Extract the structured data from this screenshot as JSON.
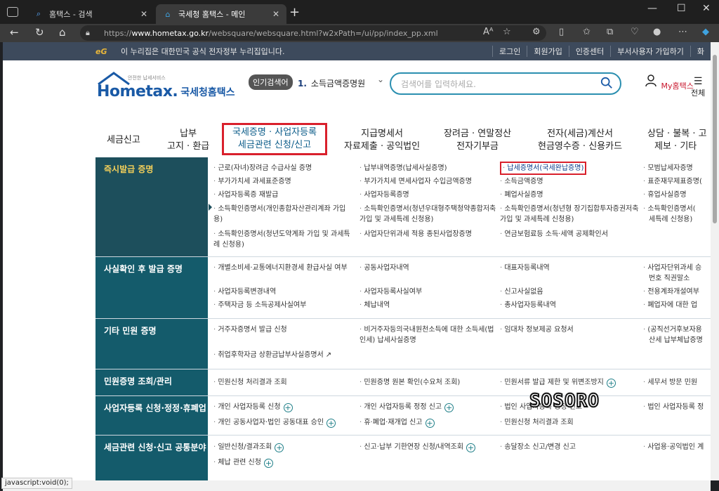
{
  "browser": {
    "tabs": [
      {
        "title": "홈택스 - 검색",
        "icon": "search-icon"
      },
      {
        "title": "국세청 홈택스 - 메인",
        "icon": "hometax-favicon"
      }
    ],
    "url_prefix": "https://",
    "url_host": "www.hometax.go.kr",
    "url_path": "/websquare/websquare.html?w2xPath=/ui/pp/index_pp.xml",
    "status_text": "javascript:void(0);"
  },
  "gov_bar": {
    "logo": "eG",
    "notice": "이 누리집은 대한민국 공식 전자정부 누리집입니다.",
    "links": [
      "로그인",
      "회원가입",
      "인증센터",
      "부서사용자 가입하기",
      "화"
    ]
  },
  "header": {
    "logo_small": "안전한 납세서비스",
    "logo_home": "Hometax.",
    "logo_name": "국세청홈택스",
    "popular_label": "인기검색어",
    "popular_rank": "1.",
    "popular_term": "소득금액증명원",
    "search_placeholder": "검색어를 입력하세요.",
    "my_label": "My홈택스",
    "all_label": "전체"
  },
  "main_nav": [
    {
      "line1": "세금신고",
      "line2": ""
    },
    {
      "line1": "납부",
      "line2": "고지 · 환급"
    },
    {
      "line1": "국세증명 · 사업자등록",
      "line2": "세금관련 신청/신고"
    },
    {
      "line1": "지급명세서",
      "line2": "자료제출 · 공익법인"
    },
    {
      "line1": "장려금 · 연말정산",
      "line2": "전자기부금"
    },
    {
      "line1": "전자(세금)계산서",
      "line2": "현금영수증 · 신용카드"
    },
    {
      "line1": "상담 · 불복 · 고",
      "line2": "제보 · 기타"
    }
  ],
  "sections": [
    {
      "title": "즉시발급 증명",
      "items": [
        "근로(자녀)장려금 수급사실 증명",
        "납부내역증명(납세사실증명)",
        "납세증명서(국세완납증명)",
        "모범납세자증명",
        "부가가치세 과세표준증명",
        "부가가치세 면세사업자 수입금액증명",
        "소득금액증명",
        "표준재무제표증명(",
        "사업자등록증 재발급",
        "사업자등록증명",
        "폐업사실증명",
        "휴업사실증명",
        "소득확인증명서(개인종합자산관리계좌 가입용)",
        "소득확인증명서(청년우대형주택청약종합저축 가입 및 과세특례 신청용)",
        "소득확인증명서(청년형 장기집합투자증권저축 가입 및 과세특례 신청용)",
        "소득확인증명서(",
        "세특례 신청용)",
        "소득확인증명서(청년도약계좌 가입 및 과세특례 신청용)",
        "사업자단위과세 적용 종된사업장증명",
        "연금보험료등 소득·세액 공제확인서"
      ]
    },
    {
      "title": "사실확인 후 발급 증명",
      "items": [
        "개별소비세·교통에너지환경세 환급사실 여부",
        "공동사업자내역",
        "대표자등록내역",
        "사업자단위과세 승",
        "번호 직권말소",
        "사업자등록변경내역",
        "사업자등록사실여부",
        "신고사실없음",
        "전용계좌개설여부",
        "주택자금 등 소득공제사실여부",
        "체납내역",
        "총사업자등록내역",
        "폐업자에 대한 업"
      ]
    },
    {
      "title": "기타 민원 증명",
      "items": [
        "거주자증명서 발급 신청",
        "비거주자등의국내원천소득에 대한 소득세(법인세) 납세사실증명",
        "임대차 정보제공 요청서",
        "(공직선거후보자용",
        "산세 납부체납증명",
        "취업후학자금 상환금납부사실증명서"
      ]
    },
    {
      "title": "민원증명 조회/관리",
      "items": [
        "민원신청 처리결과 조회",
        "민원증명 원본 확인(수요처 조회)",
        "민원서류 발급 제한 및 위변조방지",
        "세무서 방문 민원"
      ]
    },
    {
      "title": "사업자등록 신청·정정·휴폐업",
      "items": [
        "개인 사업자등록 신청",
        "개인 사업자등록 정정 신고",
        "법인 사업자등록 정정 신고",
        "법인 사업자등록 정",
        "개인 공동사업자·법인 공동대표 승인",
        "휴·폐업·재개업 신고",
        "민원신청 처리결과 조회"
      ]
    },
    {
      "title": "세금관련 신청·신고 공통분야",
      "items": [
        "일반신청/결과조회",
        "신고·납부 기한연장 신청/내역조회",
        "송달장소 신고/변경 신고",
        "사업용·공익법인 계",
        "체납 관련 신청"
      ]
    }
  ],
  "watermark": "SOSORO",
  "colors": {
    "accent_red": "#d9202c",
    "section_dark": "#145b6b",
    "section_first": "#1d4f5c",
    "search_border": "#2b8fb0"
  }
}
